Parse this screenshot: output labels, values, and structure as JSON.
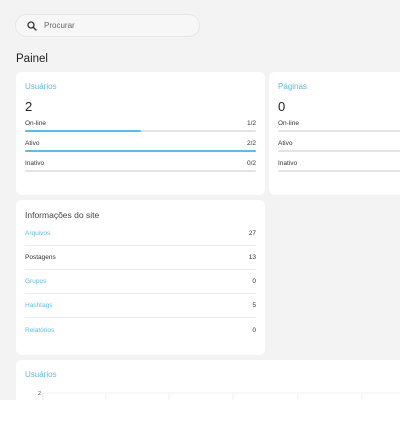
{
  "search": {
    "placeholder": "Procurar"
  },
  "page_title": "Painel",
  "users_card": {
    "title": "Usuários",
    "count": "2",
    "stats": [
      {
        "label": "On-line",
        "value": "1/2",
        "fraction": 0.5
      },
      {
        "label": "Ativo",
        "value": "2/2",
        "fraction": 1.0
      },
      {
        "label": "Inativo",
        "value": "0/2",
        "fraction": 0.0
      }
    ]
  },
  "pages_card": {
    "title": "Páginas",
    "count": "0",
    "stats": [
      {
        "label": "On-line",
        "fraction": 0.0
      },
      {
        "label": "Ativo",
        "fraction": 0.0
      },
      {
        "label": "Inativo",
        "fraction": 0.0
      }
    ]
  },
  "info_card": {
    "title": "Informações do site",
    "rows": [
      {
        "label": "Arquivos",
        "value": "27",
        "link": true
      },
      {
        "label": "Postagens",
        "value": "13",
        "link": false
      },
      {
        "label": "Grupos",
        "value": "0",
        "link": true
      },
      {
        "label": "Hashtags",
        "value": "5",
        "link": true
      },
      {
        "label": "Relatórios",
        "value": "0",
        "link": true
      }
    ]
  },
  "chart_card": {
    "title": "Usuários"
  },
  "chart_data": {
    "type": "line",
    "title": "Usuários",
    "y_tick_labels": [
      "2"
    ],
    "grid": true
  },
  "colors": {
    "accent": "#5bbde3",
    "background": "#f3f3f4",
    "card": "#ffffff"
  }
}
